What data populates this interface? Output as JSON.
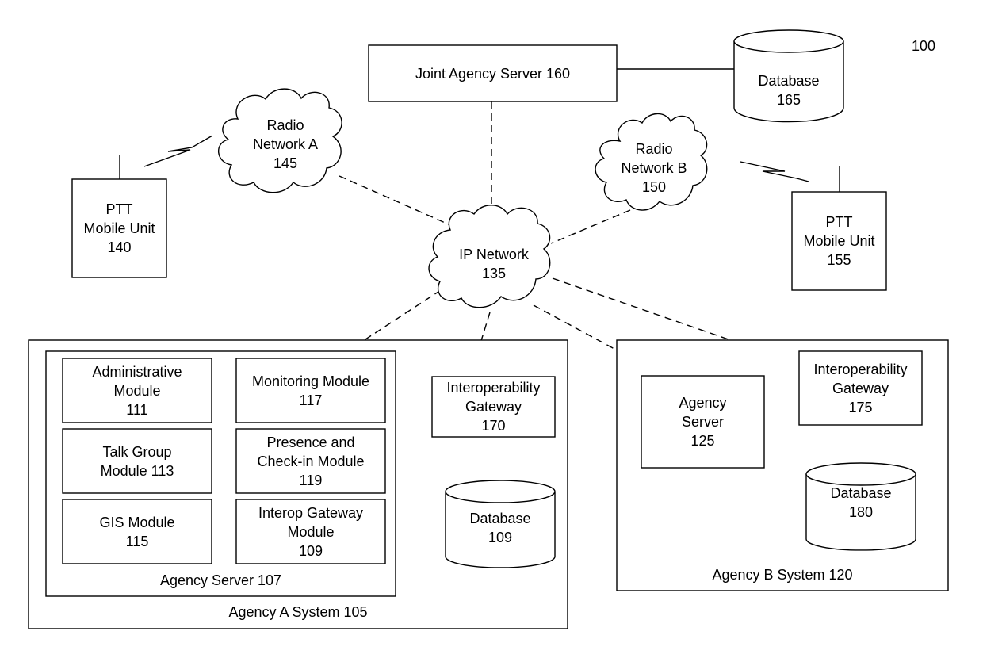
{
  "figure": {
    "number": "100"
  },
  "nodes": {
    "joint_agency_server": {
      "label": "Joint Agency Server 160"
    },
    "database_165": {
      "label": "Database\n165"
    },
    "radio_network_a": {
      "label": "Radio\nNetwork A\n145"
    },
    "radio_network_b": {
      "label": "Radio\nNetwork B\n150"
    },
    "ip_network": {
      "label": "IP Network\n135"
    },
    "ptt_mobile_140": {
      "label": "PTT\nMobile Unit\n140"
    },
    "ptt_mobile_155": {
      "label": "PTT\nMobile Unit\n155"
    },
    "agency_a_system": {
      "label": "Agency A System 105"
    },
    "agency_server_107": {
      "label": "Agency Server 107"
    },
    "administrative_module": {
      "label": "Administrative\nModule\n111"
    },
    "monitoring_module": {
      "label": "Monitoring Module\n117"
    },
    "talk_group_module": {
      "label": "Talk Group\nModule 113"
    },
    "presence_module": {
      "label": "Presence and\nCheck-in Module\n119"
    },
    "gis_module": {
      "label": "GIS Module\n115"
    },
    "interop_gateway_module": {
      "label": "Interop Gateway\nModule\n109"
    },
    "interop_gateway_170": {
      "label": "Interoperability\nGateway\n170"
    },
    "database_109": {
      "label": "Database\n109"
    },
    "agency_b_system": {
      "label": "Agency B System 120"
    },
    "agency_server_125": {
      "label": "Agency\nServer\n125"
    },
    "interop_gateway_175": {
      "label": "Interoperability\nGateway\n175"
    },
    "database_180": {
      "label": "Database\n180"
    }
  },
  "connections": [
    {
      "from": "Joint Agency Server 160",
      "to": "Database 165",
      "style": "solid"
    },
    {
      "from": "Joint Agency Server 160",
      "to": "IP Network 135",
      "style": "dashed"
    },
    {
      "from": "Radio Network A 145",
      "to": "IP Network 135",
      "style": "dashed"
    },
    {
      "from": "Radio Network B 150",
      "to": "IP Network 135",
      "style": "dashed"
    },
    {
      "from": "PTT Mobile Unit 140",
      "to": "Radio Network A 145",
      "style": "wireless"
    },
    {
      "from": "PTT Mobile Unit 155",
      "to": "Radio Network B 150",
      "style": "wireless"
    },
    {
      "from": "IP Network 135",
      "to": "Agency Server 107",
      "style": "dashed"
    },
    {
      "from": "IP Network 135",
      "to": "Interoperability Gateway 170",
      "style": "dashed"
    },
    {
      "from": "IP Network 135",
      "to": "Agency Server 125",
      "style": "dashed"
    },
    {
      "from": "IP Network 135",
      "to": "Interoperability Gateway 175",
      "style": "dashed"
    },
    {
      "from": "Agency Server 107",
      "to": "Interoperability Gateway 170",
      "style": "solid"
    },
    {
      "from": "Agency Server 107",
      "to": "Database 109",
      "style": "solid"
    },
    {
      "from": "Agency Server 125",
      "to": "Interoperability Gateway 175",
      "style": "solid"
    },
    {
      "from": "Agency Server 125",
      "to": "Database 180",
      "style": "solid"
    }
  ]
}
